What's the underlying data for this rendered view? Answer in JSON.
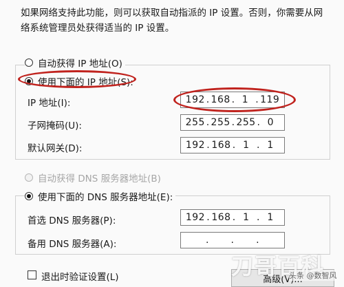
{
  "description": {
    "line1": "如果网络支持此功能，则可以获取自动指派的 IP 设置。否则，你需要从网",
    "line2": "络系统管理员处获得适当的 IP 设置。"
  },
  "ip_section": {
    "auto_label": "自动获得 IP 地址(O)",
    "manual_label": "使用下面的 IP 地址(S):",
    "selected": "manual",
    "fields": [
      {
        "label": "IP 地址(I):",
        "octets": [
          "192",
          "168",
          "1",
          "119"
        ]
      },
      {
        "label": "子网掩码(U):",
        "octets": [
          "255",
          "255",
          "255",
          "0"
        ]
      },
      {
        "label": "默认网关(D):",
        "octets": [
          "192",
          "168",
          "1",
          "1"
        ]
      }
    ]
  },
  "dns_section": {
    "auto_label": "自动获得 DNS 服务器地址(B)",
    "auto_disabled": true,
    "manual_label": "使用下面的 DNS 服务器地址(E):",
    "selected": "manual",
    "fields": [
      {
        "label": "首选 DNS 服务器(P):",
        "octets": [
          "192",
          "168",
          "1",
          "1"
        ]
      },
      {
        "label": "备用 DNS 服务器(A):",
        "octets": [
          "",
          "",
          "",
          ""
        ]
      }
    ]
  },
  "footer": {
    "validate_label": "退出时验证设置(L)",
    "validate_checked": false,
    "advanced_label": "高级(V)..."
  },
  "watermark": {
    "logo_text": "刀哥百科",
    "tag_text": "头条 @数智风"
  },
  "colors": {
    "annotation_red": "#c0221d"
  }
}
